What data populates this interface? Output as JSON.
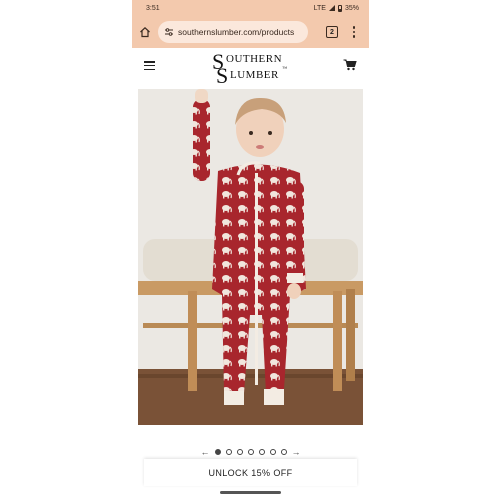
{
  "status_bar": {
    "time": "3:51",
    "network": "LTE",
    "battery": "35%"
  },
  "browser": {
    "url": "southernslumber.com/products",
    "tab_count": "2"
  },
  "site": {
    "logo_top": "OUTHERN",
    "logo_bottom": "LUMBER",
    "logo_initial": "S",
    "logo_tm": "™"
  },
  "gallery": {
    "image_alt": "Toddler wearing red elephant print zip pajamas",
    "prev_arrow": "←",
    "next_arrow": "→",
    "dot_count": 7,
    "active_index": 0
  },
  "banner": {
    "label": "UNLOCK 15% OFF"
  },
  "colors": {
    "browser_chrome": "#f3c9ad",
    "pajama_red": "#a8262d"
  }
}
